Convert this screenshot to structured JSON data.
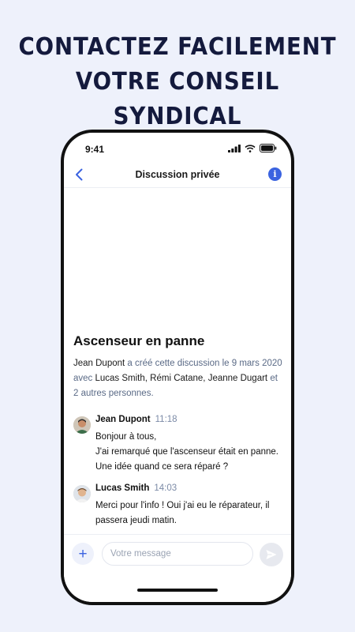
{
  "promo": {
    "headline_line1": "CONTACTEZ FACILEMENT",
    "headline_line2": "VOTRE CONSEIL SYNDICAL"
  },
  "status_bar": {
    "time": "9:41"
  },
  "navbar": {
    "title": "Discussion privée",
    "info_glyph": "i"
  },
  "topic": {
    "title": "Ascenseur en panne",
    "creator": "Jean Dupont",
    "created_text": " a créé cette discussion le 9 mars 2020 avec ",
    "participant_1": "Lucas Smith",
    "sep_1": ", ",
    "participant_2": "Rémi Catane",
    "sep_2": ", ",
    "participant_3": "Jeanne Dugart",
    "others_text": " et 2 autres personnes."
  },
  "messages": [
    {
      "author": "Jean Dupont",
      "time": "11:18",
      "line1": "Bonjour à tous,",
      "line2": "J'ai remarqué que l'ascenseur était en panne. Une idée quand ce sera réparé ?"
    },
    {
      "author": "Lucas Smith",
      "time": "14:03",
      "line1": "Merci pour l'info ! Oui j'ai eu le réparateur, il passera jeudi matin."
    }
  ],
  "composer": {
    "placeholder": "Votre message",
    "add_glyph": "+"
  },
  "colors": {
    "background": "#eef1fb",
    "headline": "#141a3d",
    "accent": "#3b63e0",
    "meta": "#5a6a86"
  },
  "icons": [
    "back-chevron-icon",
    "info-icon",
    "signal-icon",
    "wifi-icon",
    "battery-icon",
    "plus-icon",
    "send-icon"
  ]
}
